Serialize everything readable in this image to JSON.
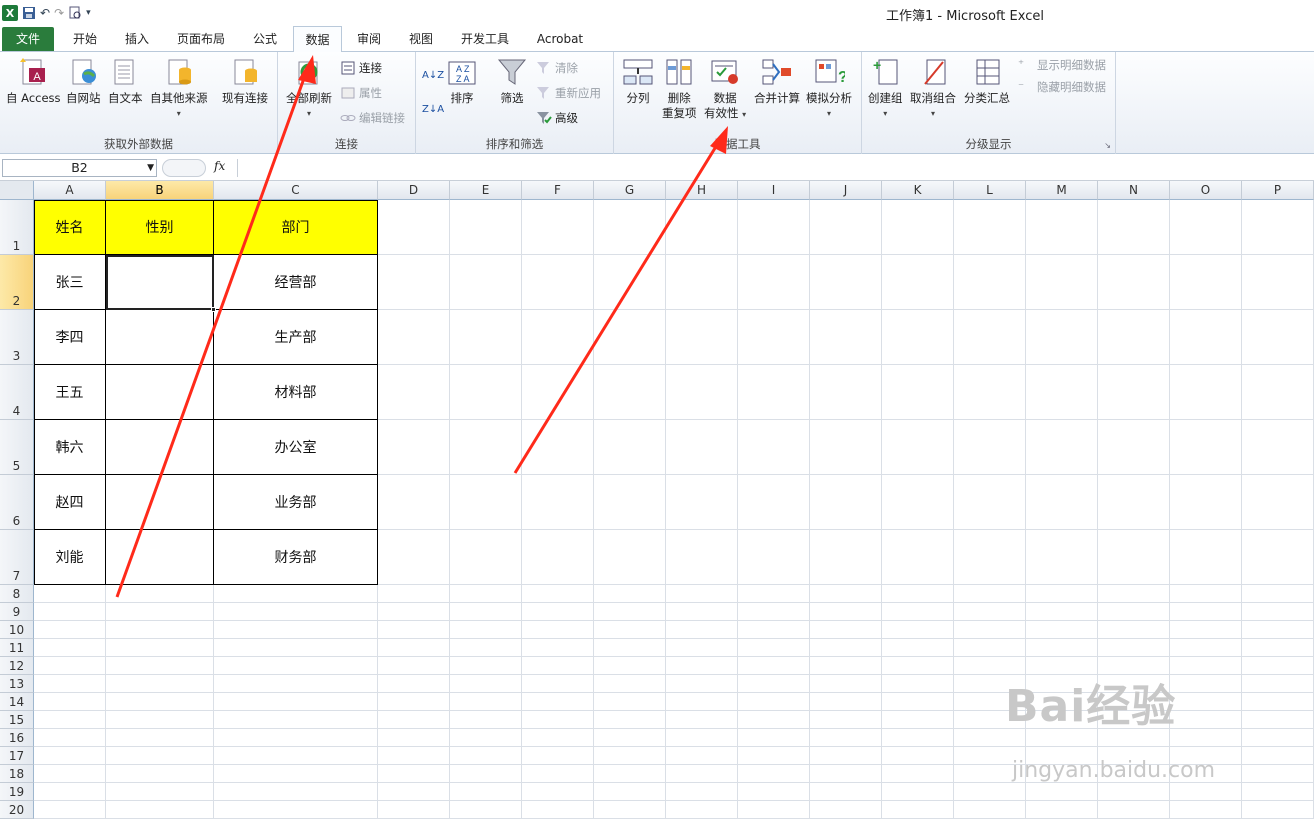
{
  "title": "工作簿1 - Microsoft Excel",
  "qat": {
    "logo": "X",
    "save": "save-icon",
    "undo": "↶",
    "redo": "↷"
  },
  "tabs": [
    "文件",
    "开始",
    "插入",
    "页面布局",
    "公式",
    "数据",
    "审阅",
    "视图",
    "开发工具",
    "Acrobat"
  ],
  "active_tab": "数据",
  "ribbon": {
    "get_external": {
      "label": "获取外部数据",
      "access": "自 Access",
      "web": "自网站",
      "text": "自文本",
      "other": "自其他来源",
      "existing": "现有连接"
    },
    "connections": {
      "label": "连接",
      "refresh_all": "全部刷新",
      "connections": "连接",
      "properties": "属性",
      "edit_links": "编辑链接"
    },
    "sort_filter": {
      "label": "排序和筛选",
      "sort": "排序",
      "filter": "筛选",
      "clear": "清除",
      "reapply": "重新应用",
      "advanced": "高级"
    },
    "data_tools": {
      "label": "数据工具",
      "text_to_columns": "分列",
      "remove_dup_1": "删除",
      "remove_dup_2": "重复项",
      "validation_1": "数据",
      "validation_2": "有效性",
      "consolidate": "合并计算",
      "what_if": "模拟分析"
    },
    "outline": {
      "label": "分级显示",
      "group": "创建组",
      "ungroup": "取消组合",
      "subtotal": "分类汇总",
      "show_detail": "显示明细数据",
      "hide_detail": "隐藏明细数据"
    }
  },
  "formula_bar": {
    "name_box": "B2",
    "fx": "fx",
    "value": ""
  },
  "columns": [
    "A",
    "B",
    "C",
    "D",
    "E",
    "F",
    "G",
    "H",
    "I",
    "J",
    "K",
    "L",
    "M",
    "N",
    "O",
    "P"
  ],
  "rows": [
    "1",
    "2",
    "3",
    "4",
    "5",
    "6",
    "7",
    "8",
    "9",
    "10",
    "11",
    "12",
    "13",
    "14",
    "15",
    "16",
    "17",
    "18",
    "19",
    "20"
  ],
  "table": {
    "headers": [
      "姓名",
      "性别",
      "部门"
    ],
    "rows": [
      [
        "张三",
        "",
        "经营部"
      ],
      [
        "李四",
        "",
        "生产部"
      ],
      [
        "王五",
        "",
        "材料部"
      ],
      [
        "韩六",
        "",
        "办公室"
      ],
      [
        "赵四",
        "",
        "业务部"
      ],
      [
        "刘能",
        "",
        "财务部"
      ]
    ]
  },
  "watermark": {
    "main": "Bai经验",
    "sub": "jingyan.baidu.com"
  },
  "colors": {
    "header_fill": "#ffff00",
    "arrow": "#ff2a1a",
    "file_tab": "#2a7c3c"
  }
}
